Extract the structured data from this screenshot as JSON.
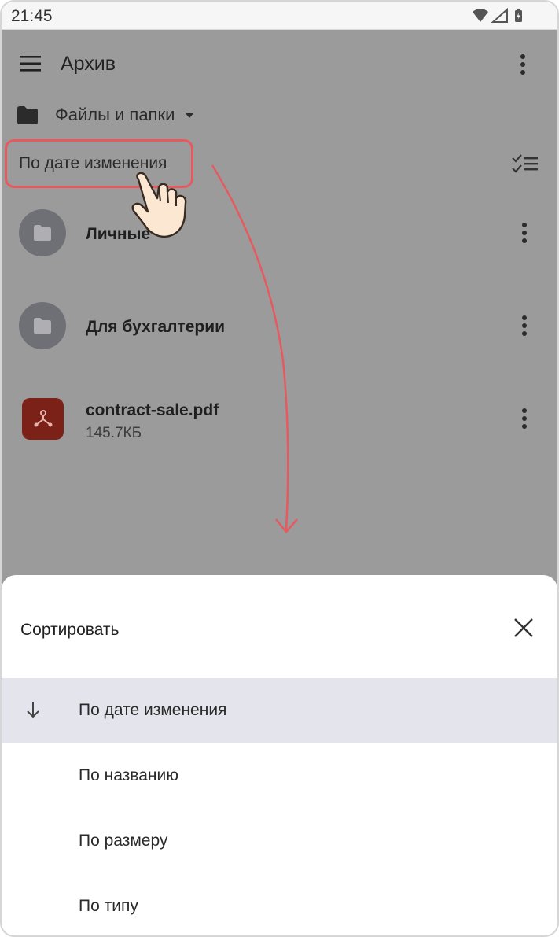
{
  "status_bar": {
    "time": "21:45"
  },
  "app_bar": {
    "title": "Архив"
  },
  "folder_selector": {
    "label": "Файлы и папки"
  },
  "sort_chip": {
    "label": "По дате изменения"
  },
  "files": [
    {
      "name": "Личные",
      "type": "folder"
    },
    {
      "name": "Для бухгалтерии",
      "type": "folder"
    },
    {
      "name": "contract-sale.pdf",
      "size": "145.7КБ",
      "type": "pdf"
    }
  ],
  "sort_sheet": {
    "title": "Сортировать",
    "options": [
      {
        "label": "По дате изменения",
        "selected": true
      },
      {
        "label": "По названию",
        "selected": false
      },
      {
        "label": "По размеру",
        "selected": false
      },
      {
        "label": "По типу",
        "selected": false
      }
    ]
  },
  "colors": {
    "highlight": "#e65a5f",
    "overlay": "#9b9b9b",
    "pdf_icon": "#7b2118",
    "selected_option": "#e4e4ec"
  },
  "icons": [
    "wifi-icon",
    "signal-icon",
    "battery-icon",
    "menu-icon",
    "more-vert-icon",
    "folder-icon",
    "caret-down-icon",
    "checklist-icon",
    "pdf-icon",
    "close-icon",
    "arrow-down-icon",
    "hand-pointer-icon"
  ]
}
